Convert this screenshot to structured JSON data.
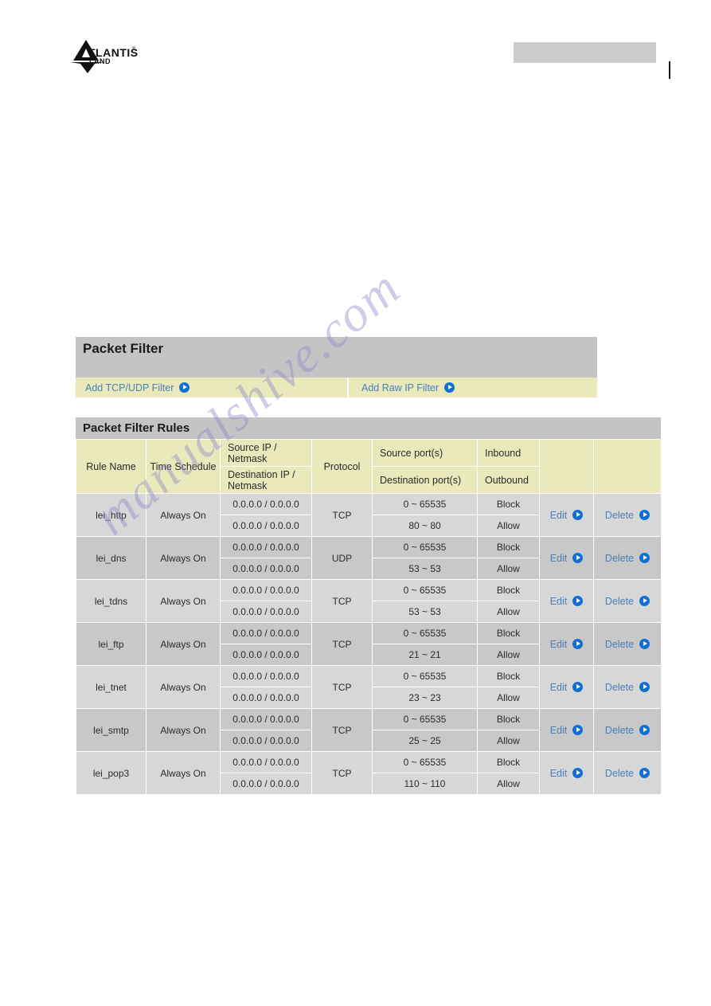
{
  "header": {
    "logo_primary": "ATLANTIS",
    "logo_registered": "®",
    "logo_secondary": "LAND"
  },
  "watermark": {
    "text": "manualshive.com"
  },
  "panel": {
    "title": "Packet Filter",
    "links": [
      {
        "label": "Add TCP/UDP Filter",
        "icon": "arrow-right-circle-icon"
      },
      {
        "label": "Add Raw IP Filter",
        "icon": "arrow-right-circle-icon"
      }
    ]
  },
  "rules_table": {
    "title": "Packet Filter Rules",
    "headers": {
      "rule_name": "Rule Name",
      "time_schedule": "Time Schedule",
      "source_ip": "Source IP / Netmask",
      "destination_ip": "Destination IP / Netmask",
      "protocol": "Protocol",
      "source_ports": "Source port(s)",
      "destination_ports": "Destination port(s)",
      "inbound": "Inbound",
      "outbound": "Outbound",
      "edit_col": "",
      "delete_col": ""
    },
    "actions": {
      "edit": "Edit",
      "delete": "Delete"
    },
    "rows": [
      {
        "rule_name": "lei_http",
        "time_schedule": "Always On",
        "source_ip": "0.0.0.0 / 0.0.0.0",
        "destination_ip": "0.0.0.0 / 0.0.0.0",
        "protocol": "TCP",
        "source_ports": "0 ~ 65535",
        "destination_ports": "80 ~ 80",
        "inbound": "Block",
        "outbound": "Allow"
      },
      {
        "rule_name": "lei_dns",
        "time_schedule": "Always On",
        "source_ip": "0.0.0.0 / 0.0.0.0",
        "destination_ip": "0.0.0.0 / 0.0.0.0",
        "protocol": "UDP",
        "source_ports": "0 ~ 65535",
        "destination_ports": "53 ~ 53",
        "inbound": "Block",
        "outbound": "Allow"
      },
      {
        "rule_name": "lei_tdns",
        "time_schedule": "Always On",
        "source_ip": "0.0.0.0 / 0.0.0.0",
        "destination_ip": "0.0.0.0 / 0.0.0.0",
        "protocol": "TCP",
        "source_ports": "0 ~ 65535",
        "destination_ports": "53 ~ 53",
        "inbound": "Block",
        "outbound": "Allow"
      },
      {
        "rule_name": "lei_ftp",
        "time_schedule": "Always On",
        "source_ip": "0.0.0.0 / 0.0.0.0",
        "destination_ip": "0.0.0.0 / 0.0.0.0",
        "protocol": "TCP",
        "source_ports": "0 ~ 65535",
        "destination_ports": "21 ~ 21",
        "inbound": "Block",
        "outbound": "Allow"
      },
      {
        "rule_name": "lei_tnet",
        "time_schedule": "Always On",
        "source_ip": "0.0.0.0 / 0.0.0.0",
        "destination_ip": "0.0.0.0 / 0.0.0.0",
        "protocol": "TCP",
        "source_ports": "0 ~ 65535",
        "destination_ports": "23 ~ 23",
        "inbound": "Block",
        "outbound": "Allow"
      },
      {
        "rule_name": "lei_smtp",
        "time_schedule": "Always On",
        "source_ip": "0.0.0.0 / 0.0.0.0",
        "destination_ip": "0.0.0.0 / 0.0.0.0",
        "protocol": "TCP",
        "source_ports": "0 ~ 65535",
        "destination_ports": "25 ~ 25",
        "inbound": "Block",
        "outbound": "Allow"
      },
      {
        "rule_name": "lei_pop3",
        "time_schedule": "Always On",
        "source_ip": "0.0.0.0 / 0.0.0.0",
        "destination_ip": "0.0.0.0 / 0.0.0.0",
        "protocol": "TCP",
        "source_ports": "0 ~ 65535",
        "destination_ports": "110 ~ 110",
        "inbound": "Block",
        "outbound": "Allow"
      }
    ]
  },
  "colors": {
    "title_bar": "#c4c4c4",
    "khaki": "#e9e9bb",
    "link_blue": "#4a7fba",
    "icon_blue": "#0f6fd4",
    "row_odd": "#d7d7d7",
    "row_even": "#c8c8c8"
  }
}
